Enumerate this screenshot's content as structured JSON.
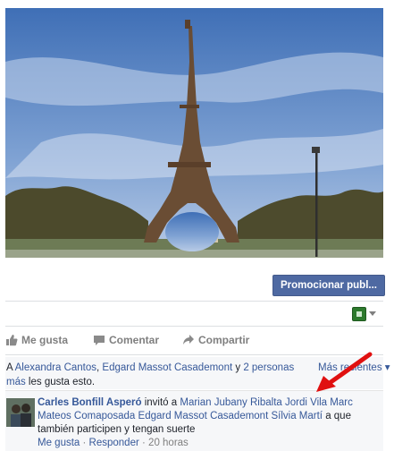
{
  "post": {
    "photo_alt": "",
    "promote_button": "Promocionar publ...",
    "audience_icon": "group-audience-icon"
  },
  "actions": {
    "like": "Me gusta",
    "comment": "Comentar",
    "share": "Compartir"
  },
  "likes": {
    "prefix": "A ",
    "name1": "Alexandra Cantos",
    "sep1": ", ",
    "name2": "Edgard Massot Casademont",
    "sep2": " y ",
    "others": "2 personas más",
    "suffix": " les gusta esto.",
    "more_link": "Más recientes"
  },
  "comment": {
    "author": "Carles Bonfill Asperó",
    "verb": " invitó a ",
    "invitee1": "Marian Jubany Ribalta",
    "invitee2": "Jordi Vila Marc Mateos",
    "invitee3": "Comaposada",
    "invitee4": "Edgard Massot Casademont",
    "invitee5": "Sílvia Martí",
    "tail": " a que también participen y tengan suerte",
    "like_link": "Me gusta",
    "dot1": " · ",
    "reply_link": "Responder",
    "dot2": " · ",
    "time": "20 horas"
  },
  "colors": {
    "link": "#365899",
    "button": "#4e69a2",
    "arrow": "#e01010"
  }
}
